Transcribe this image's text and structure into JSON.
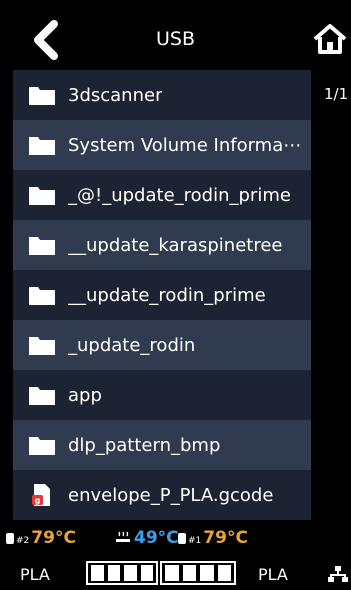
{
  "header": {
    "title": "USB",
    "back_icon": "chevron-left-icon",
    "home_icon": "home-icon"
  },
  "page_indicator": "1/1",
  "files": [
    {
      "name": "3dscanner",
      "type": "folder"
    },
    {
      "name": "System Volume Informa⋯",
      "type": "folder"
    },
    {
      "name": "_@!_update_rodin_prime",
      "type": "folder"
    },
    {
      "name": "__update_karaspinetree",
      "type": "folder"
    },
    {
      "name": "__update_rodin_prime",
      "type": "folder"
    },
    {
      "name": "_update_rodin",
      "type": "folder"
    },
    {
      "name": "app",
      "type": "folder"
    },
    {
      "name": "dlp_pattern_bmp",
      "type": "folder"
    },
    {
      "name": "envelope_P_PLA.gcode",
      "type": "gcode-file"
    }
  ],
  "status": {
    "nozzle2": {
      "label": "#2",
      "temp": "79°C",
      "color": "#e8a33a"
    },
    "bed": {
      "temp": "49°C",
      "color": "#3aa0e8"
    },
    "nozzle1": {
      "label": "#1",
      "temp": "79°C",
      "color": "#e8a33a"
    },
    "filament_left": "PLA",
    "filament_right": "PLA",
    "network_icon": "network-icon"
  }
}
